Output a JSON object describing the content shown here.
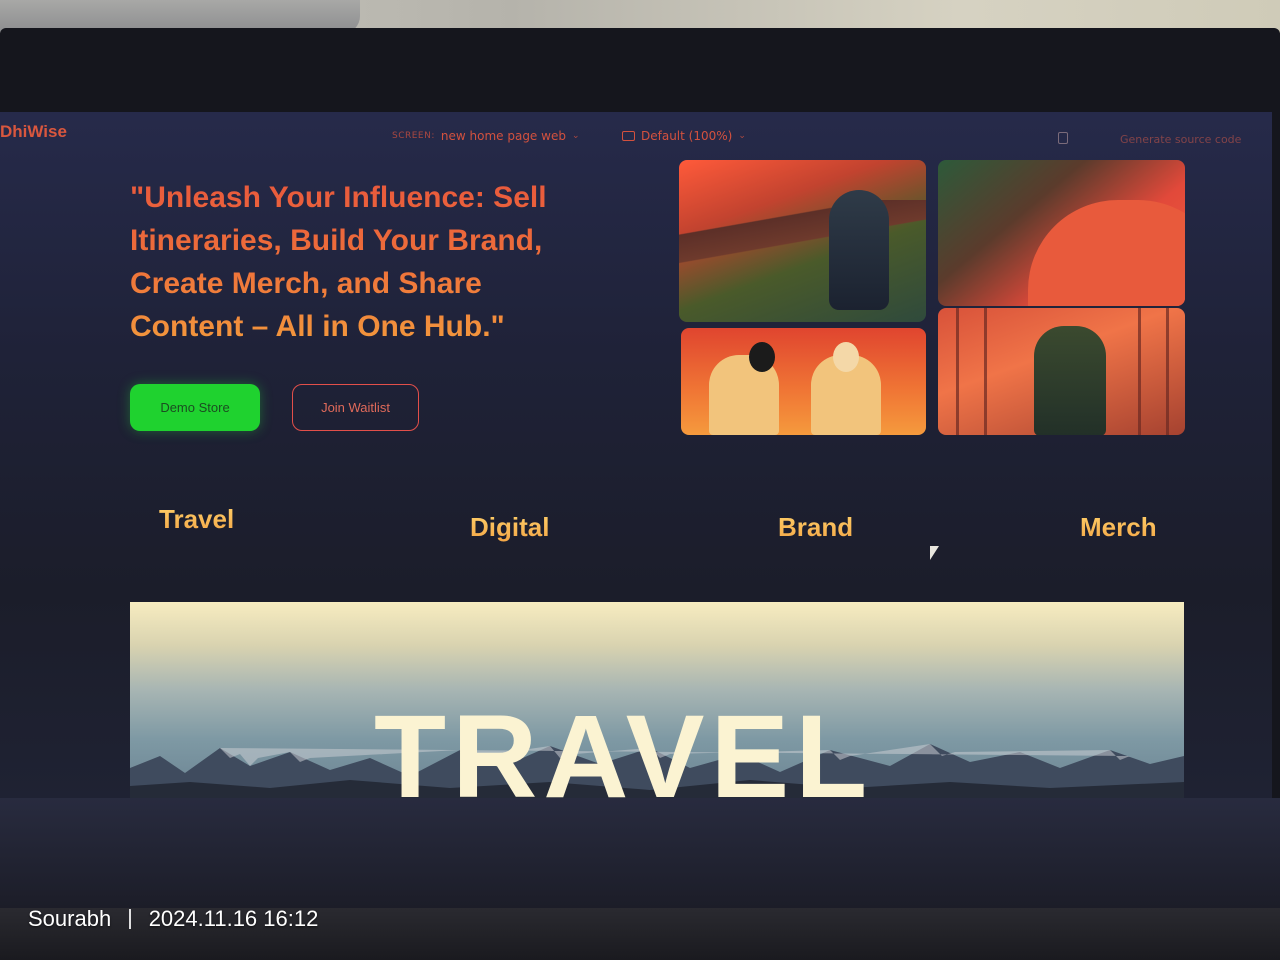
{
  "app": {
    "logo": "DhiWise",
    "screen_label": "SCREEN:",
    "screen_name": "new home page web",
    "zoom": "Default (100%)",
    "generate_button": "Generate source code"
  },
  "hero": {
    "headline": "\"Unleash Your Influence: Sell Itineraries, Build Your Brand, Create Merch, and Share Content – All in One Hub.\"",
    "primary_button": "Demo Store",
    "secondary_button": "Join Waitlist"
  },
  "categories": [
    "Travel",
    "Digital",
    "Brand",
    "Merch"
  ],
  "banner": {
    "title": "TRAVEL"
  },
  "photo_watermark": {
    "name": "Sourabh",
    "timestamp": "2024.11.16 16:12"
  },
  "colors": {
    "accent_orange": "#ee6f3a",
    "demo_green": "#1fd22f",
    "waitlist_border": "#e24f4a",
    "category_gold": "#ffd06a"
  }
}
